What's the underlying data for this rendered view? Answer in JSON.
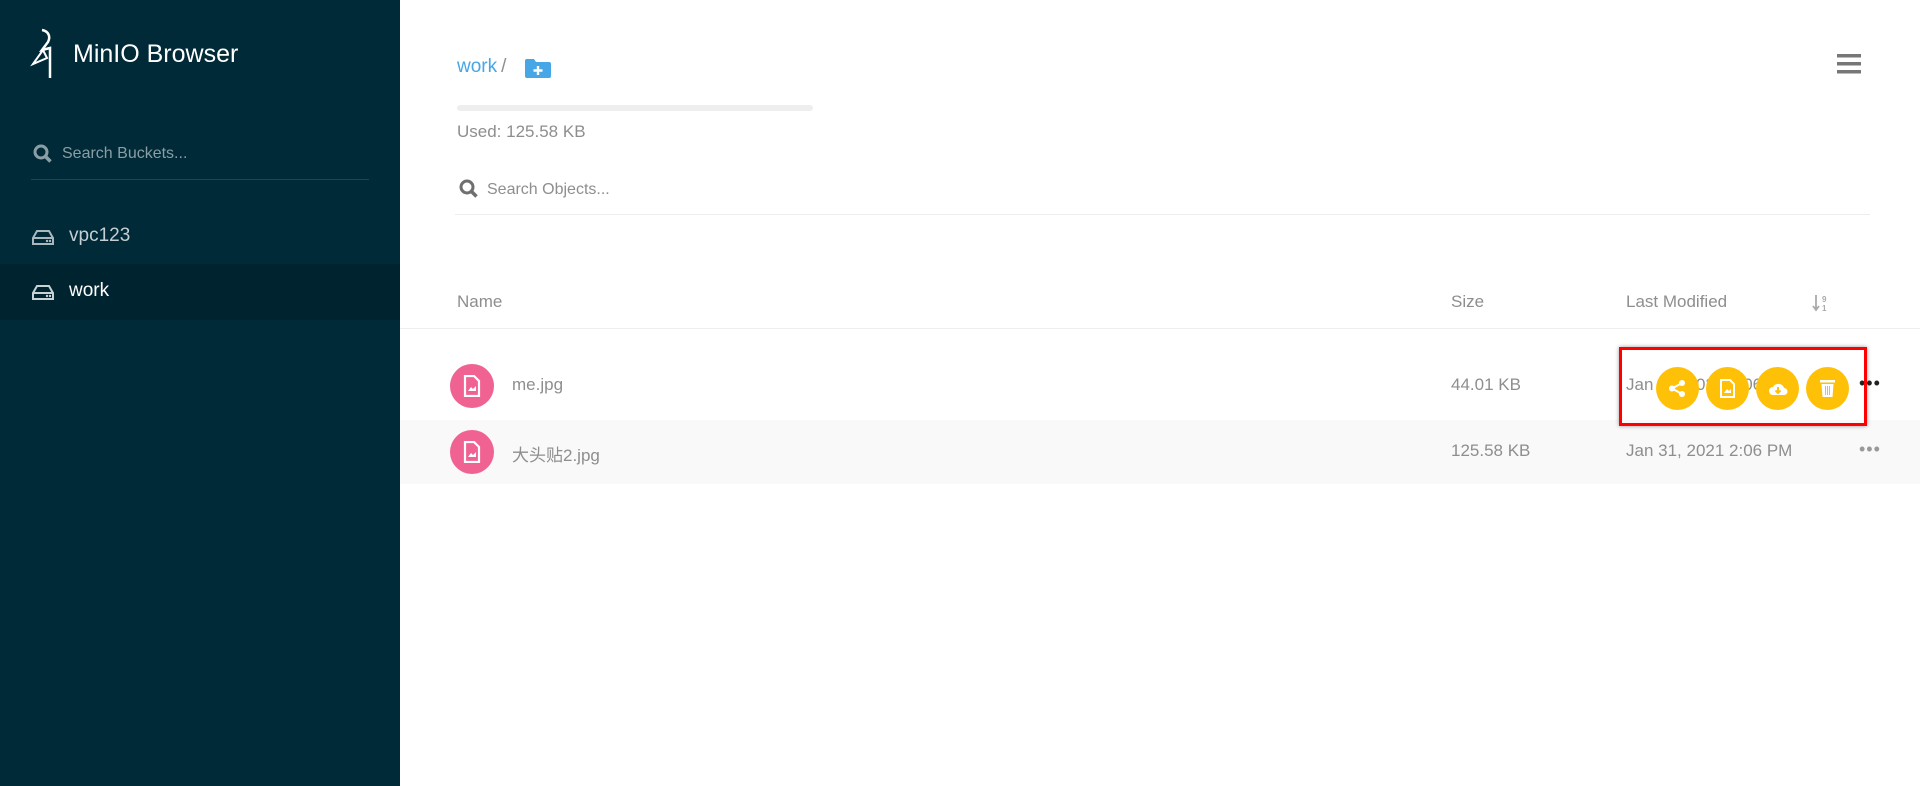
{
  "app": {
    "title": "MinIO Browser"
  },
  "sidebar": {
    "search_placeholder": "Search Buckets...",
    "buckets": [
      {
        "label": "vpc123",
        "active": false
      },
      {
        "label": "work",
        "active": true
      }
    ]
  },
  "main": {
    "breadcrumb": {
      "bucket": "work",
      "separator": "/"
    },
    "usage": {
      "label": "Used: 125.58 KB",
      "fill_percent": 0
    },
    "search_placeholder": "Search Objects...",
    "columns": {
      "name": "Name",
      "size": "Size",
      "modified": "Last Modified"
    },
    "objects": [
      {
        "name": "me.jpg",
        "size": "44.01 KB",
        "modified": "Jan 31, 2021 2:06 PM"
      },
      {
        "name": "大头贴2.jpg",
        "size": "125.58 KB",
        "modified": "Jan 31, 2021 2:06 PM"
      }
    ],
    "more_label": "•••",
    "row_actions": [
      "share-icon",
      "preview-icon",
      "download-icon",
      "delete-icon"
    ]
  },
  "colors": {
    "sidebar": "#002a37",
    "accent": "#46a6e6",
    "file_icon": "#f06292",
    "action": "#ffc107",
    "highlight": "#ff0000"
  }
}
